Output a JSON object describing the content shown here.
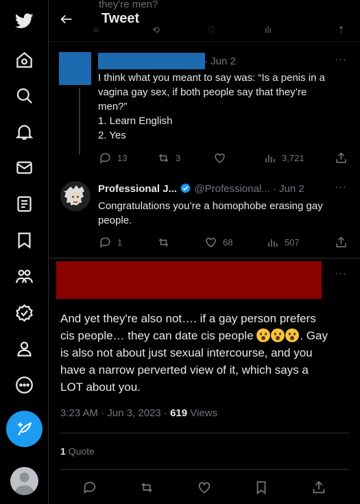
{
  "header": {
    "title": "Tweet"
  },
  "ghost": {
    "text": "they're men?"
  },
  "reply1": {
    "date": "· Jun 2",
    "lines": [
      "I think what you meant to say was: “Is a penis in a",
      "vagina gay sex, if both people say that they’re",
      "men?”",
      "1. Learn English",
      "2. Yes"
    ],
    "replies": "13",
    "retweets": "3",
    "likes": "",
    "views": "3,721"
  },
  "reply2": {
    "name": "Professional J...",
    "handle": "@Professional...",
    "date": "· Jun 2",
    "lines": [
      "Congratulations you’re a homophobe erasing gay",
      "people."
    ],
    "replies": "1",
    "retweets": "",
    "likes": "68",
    "views": "507"
  },
  "main_tweet": {
    "line1": "And yet they're also not…. if a gay person prefers",
    "line2a": "cis people… they can date cis people ",
    "line2b": ". Gay",
    "line3": "is also not about just sexual intercourse, and you",
    "line4": "have a narrow perverted view of it, which says a",
    "line5": "LOT about you.",
    "timestamp": "3:23 AM · Jun 3, 2023 · ",
    "views_count": "619",
    "views_label": " Views",
    "quote_count": "1",
    "quote_label": " Quote"
  },
  "icons": {
    "nav": [
      "twitter-logo-icon",
      "home-icon",
      "search-icon",
      "notifications-icon",
      "messages-icon",
      "lists-icon",
      "bookmarks-icon",
      "communities-icon",
      "verified-icon",
      "profile-icon",
      "more-icon"
    ],
    "accent": "#1d9bf0"
  }
}
